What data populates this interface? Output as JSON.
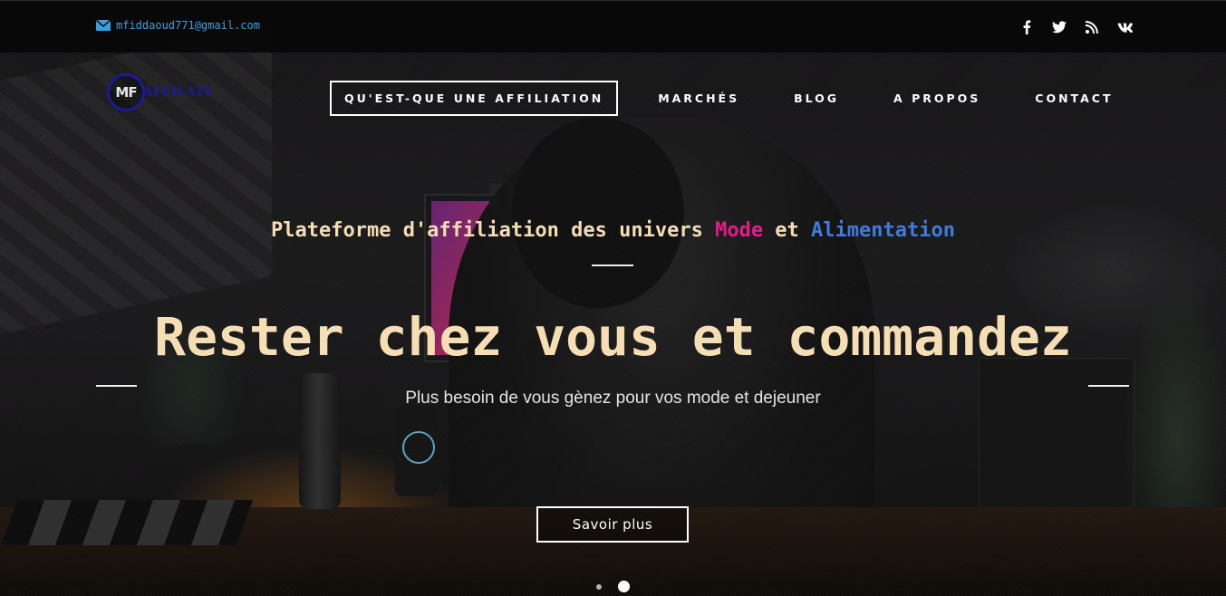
{
  "topbar": {
    "email": "mfiddaoud771@gmail.com",
    "email_icon": "mail-icon",
    "socials": [
      {
        "name": "facebook-icon"
      },
      {
        "name": "twitter-icon"
      },
      {
        "name": "rss-icon"
      },
      {
        "name": "vk-icon"
      }
    ]
  },
  "header": {
    "logo_mark": "MF",
    "logo_text": "AFFILATE"
  },
  "nav": {
    "items": [
      {
        "label": "QU'EST-QUE UNE AFFILIATION",
        "active": true
      },
      {
        "label": "MARCHÉS"
      },
      {
        "label": "BLOG"
      },
      {
        "label": "A PROPOS"
      },
      {
        "label": "CONTACT"
      }
    ]
  },
  "hero": {
    "subtitle_part1": "Plateforme d'affiliation des univers ",
    "subtitle_mode": "Mode",
    "subtitle_part2": " et ",
    "subtitle_alimentation": "Alimentation",
    "title": "Rester chez vous et commandez",
    "description": "Plus besoin de vous gènez pour vos mode et dejeuner",
    "cta_label": "Savoir plus"
  },
  "carousel": {
    "slide_count": 2,
    "active_index": 1
  },
  "colors": {
    "accent_pink": "#e21d8a",
    "accent_blue": "#3d7be0",
    "title_color": "#f5deb3",
    "email_color": "#3a9fe0",
    "logo_color": "#1a1a9a"
  }
}
